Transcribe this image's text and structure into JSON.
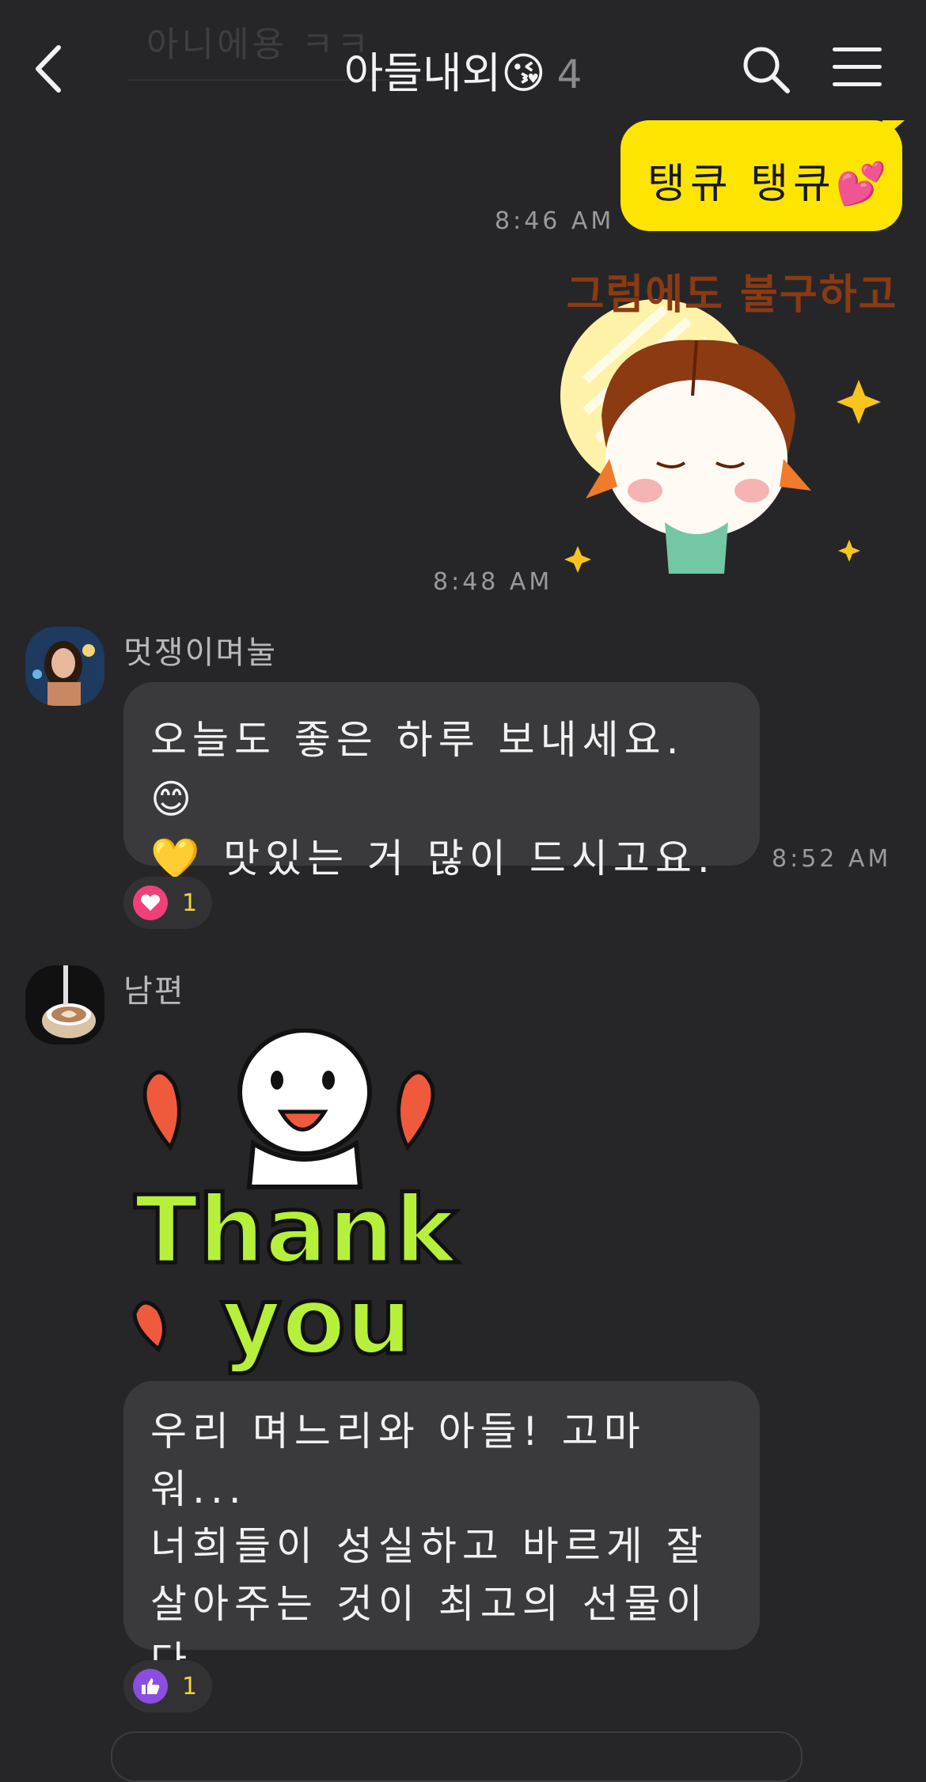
{
  "header": {
    "ghost_text": "아니에용 ㅋㅋ",
    "title": "아들내외😘",
    "member_count": "4",
    "icons": [
      "chevron-left-icon",
      "search-icon",
      "menu-icon"
    ]
  },
  "messages": [
    {
      "from": "me",
      "text": "탱큐 탱큐💕",
      "time": "8:46 AM"
    },
    {
      "from": "me",
      "sticker_caption": "그럼에도 불구하고",
      "time": "8:48 AM"
    },
    {
      "from": "멋쟁이며눌",
      "text_line1": "오늘도 좋은 하루 보내세요. 😊",
      "text_line2": "💛 맛있는 거 많이 드시고요.",
      "time": "8:52 AM",
      "reaction": {
        "icon": "heart-icon",
        "count": "1"
      }
    },
    {
      "from": "남편",
      "sticker_text_line1": "Thank",
      "sticker_text_line2": "you",
      "text_lines": [
        "우리 며느리와 아들! 고마워...",
        "너희들이 성실하고 바르게 잘",
        "살아주는 것이 최고의 선물이",
        "다."
      ],
      "reaction": {
        "icon": "thumbs-up-icon",
        "count": "1"
      }
    }
  ],
  "colors": {
    "background": "#262628",
    "my_bubble": "#fee500",
    "other_bubble": "#3a3a3c"
  }
}
